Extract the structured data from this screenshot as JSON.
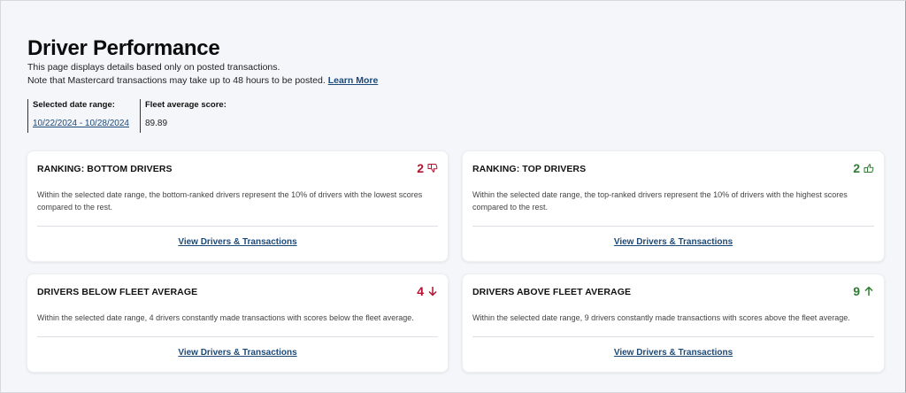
{
  "header": {
    "title": "Driver Performance",
    "line1": "This page displays details based only on posted transactions.",
    "line2": "Note that Mastercard transactions may take up to 48 hours to be posted.",
    "learn_more": "Learn More"
  },
  "meta": {
    "date_range_label": "Selected date range:",
    "date_range_value": "10/22/2024 - 10/28/2024",
    "fleet_avg_label": "Fleet average score:",
    "fleet_avg_value": "89.89"
  },
  "cards": [
    {
      "title": "RANKING: BOTTOM DRIVERS",
      "count": "2",
      "icon": "thumbs-down-icon",
      "desc": "Within the selected date range, the bottom-ranked drivers represent the 10% of drivers with the lowest scores compared to the rest.",
      "link": "View Drivers & Transactions"
    },
    {
      "title": "RANKING: TOP DRIVERS",
      "count": "2",
      "icon": "thumbs-up-icon",
      "desc": "Within the selected date range, the top-ranked drivers represent the 10% of drivers with the highest scores compared to the rest.",
      "link": "View Drivers & Transactions"
    },
    {
      "title": "DRIVERS BELOW FLEET AVERAGE",
      "count": "4",
      "icon": "arrow-down-icon",
      "desc": "Within the selected date range, 4 drivers constantly made transactions with scores below the fleet average.",
      "link": "View Drivers & Transactions"
    },
    {
      "title": "DRIVERS ABOVE FLEET AVERAGE",
      "count": "9",
      "icon": "arrow-up-icon",
      "desc": "Within the selected date range, 9 drivers constantly made transactions with scores above the fleet average.",
      "link": "View Drivers & Transactions"
    }
  ],
  "colors": {
    "negative": "#b3122e",
    "positive": "#2f7d32",
    "link": "#1c4a78"
  }
}
